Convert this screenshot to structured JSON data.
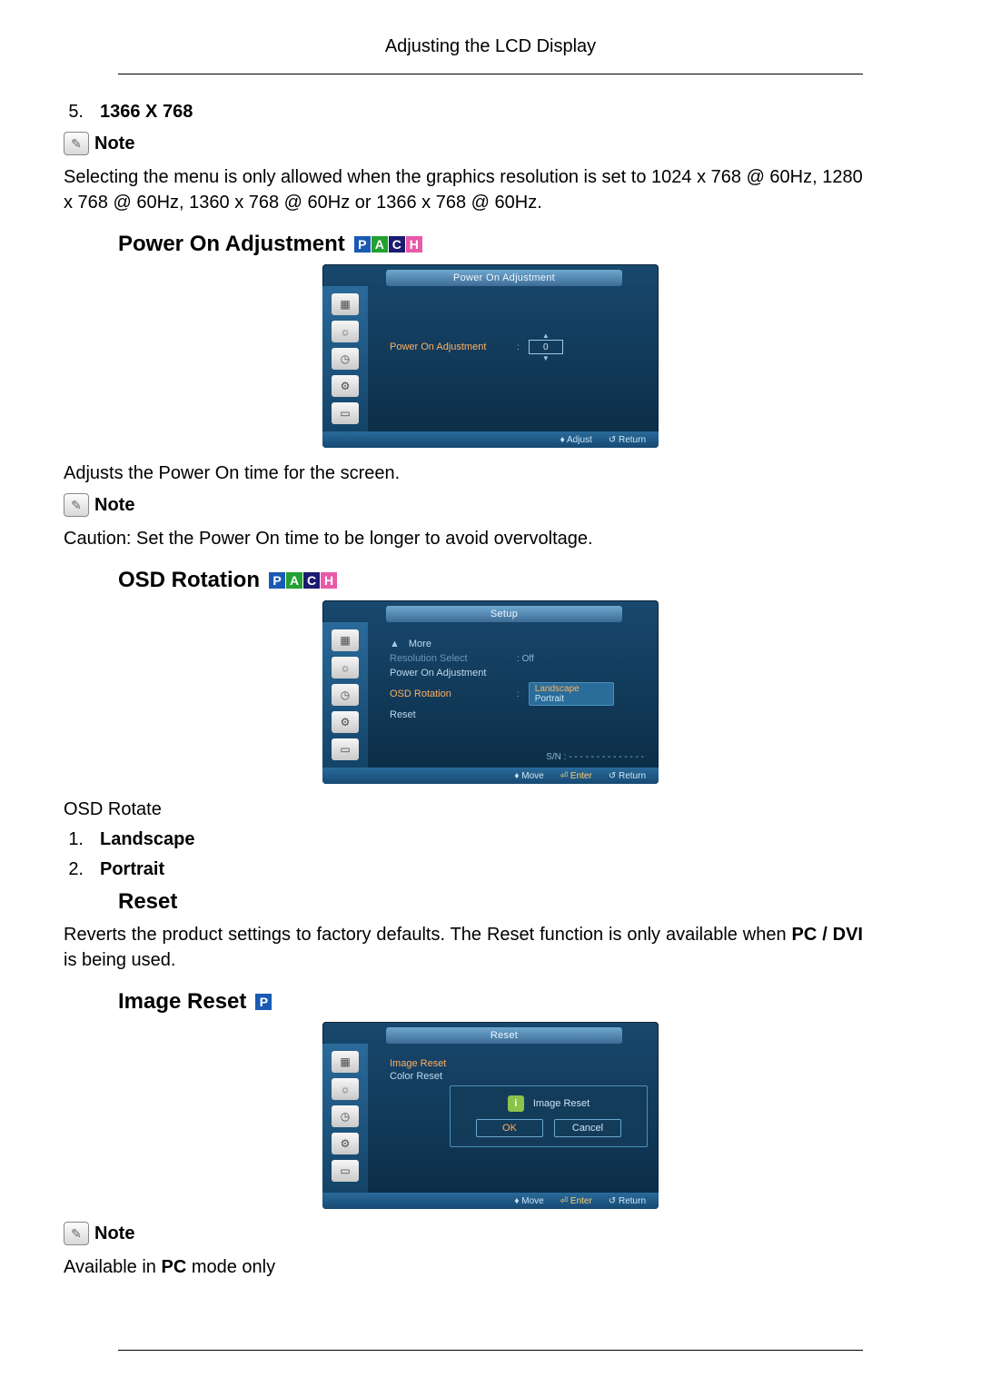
{
  "header": {
    "title": "Adjusting the LCD Display"
  },
  "item5": {
    "num": "5.",
    "label": "1366 X 768"
  },
  "note_label": "Note",
  "item5_note_text": "Selecting the menu is only allowed when the graphics resolution is set to 1024 x 768 @ 60Hz, 1280 x 768 @ 60Hz, 1360 x 768 @ 60Hz or 1366 x 768 @ 60Hz.",
  "power_on": {
    "heading": "Power On Adjustment",
    "osd_title": "Power On Adjustment",
    "osd_label": "Power On Adjustment",
    "osd_value": "0",
    "footer_adjust": "Adjust",
    "footer_return": "Return",
    "desc": "Adjusts the Power On time for the screen.",
    "caution": "Caution: Set the Power On time to be longer to avoid overvoltage."
  },
  "osd_rotation": {
    "heading": "OSD Rotation",
    "osd_title": "Setup",
    "more": "More",
    "res_select": "Resolution Select",
    "res_value": "Off",
    "poa": "Power On Adjustment",
    "rot": "OSD Rotation",
    "rot_opt1": "Landscape",
    "rot_opt2": "Portrait",
    "reset": "Reset",
    "sn_label": "S/N :",
    "sn_value": "- - - - - - - - - - - - - -",
    "footer_move": "Move",
    "footer_enter": "Enter",
    "footer_return": "Return",
    "body_label": "OSD Rotate",
    "list1_num": "1.",
    "list1_label": "Landscape",
    "list2_num": "2.",
    "list2_label": "Portrait"
  },
  "reset": {
    "heading": "Reset",
    "text_a": "Reverts the product settings to factory defaults. The Reset function is only available when ",
    "text_bold": "PC / DVI",
    "text_b": " is being used."
  },
  "image_reset": {
    "heading": "Image Reset",
    "osd_title": "Reset",
    "menu1": "Image Reset",
    "menu2": "Color Reset",
    "dialog_title": "Image Reset",
    "btn_ok": "OK",
    "btn_cancel": "Cancel",
    "footer_move": "Move",
    "footer_enter": "Enter",
    "footer_return": "Return",
    "note_text_a": "Available in ",
    "note_text_bold": "PC",
    "note_text_b": " mode only"
  }
}
